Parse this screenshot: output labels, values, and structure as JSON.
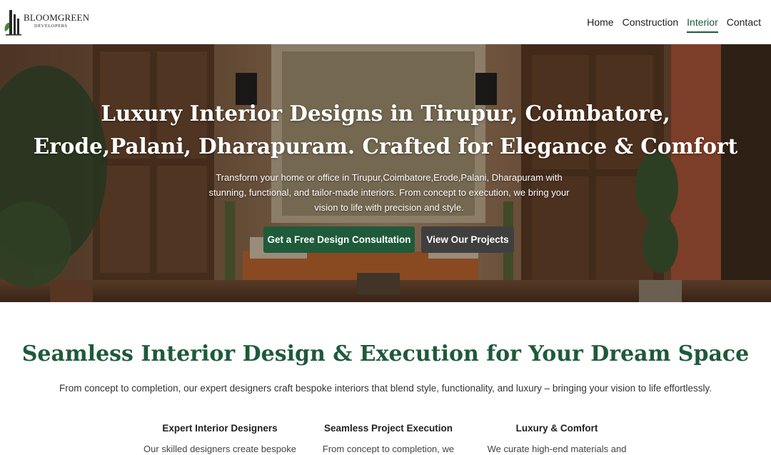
{
  "brand": {
    "name_main": "BLOOMGREEN",
    "name_sub": "DEVELOPERS",
    "colors": {
      "green": "#1f5a3a",
      "dark_button": "#3f3f3f"
    }
  },
  "nav": {
    "items": [
      {
        "label": "Home"
      },
      {
        "label": "Construction"
      },
      {
        "label": "Interior"
      },
      {
        "label": "Contact"
      }
    ],
    "active": "Interior"
  },
  "hero": {
    "title": "Luxury Interior Designs in Tirupur, Coimbatore, Erode,Palani, Dharapuram. Crafted for Elegance & Comfort",
    "subtitle": "Transform your home or office in Tirupur,Coimbatore,Erode,Palani, Dharapuram with stunning, functional, and tailor-made interiors. From concept to execution, we bring your vision to life with precision and style.",
    "primary_button": "Get a Free Design Consultation",
    "secondary_button": "View Our Projects"
  },
  "section": {
    "title": "Seamless Interior Design & Execution for Your Dream Space",
    "subtitle": "From concept to completion, our expert designers craft bespoke interiors that blend style, functionality, and luxury – bringing your vision to life effortlessly.",
    "features": [
      {
        "title": "Expert Interior Designers",
        "text": "Our skilled designers create bespoke"
      },
      {
        "title": "Seamless Project Execution",
        "text": "From concept to completion, we"
      },
      {
        "title": "Luxury & Comfort",
        "text": "We curate high-end materials and"
      }
    ]
  }
}
